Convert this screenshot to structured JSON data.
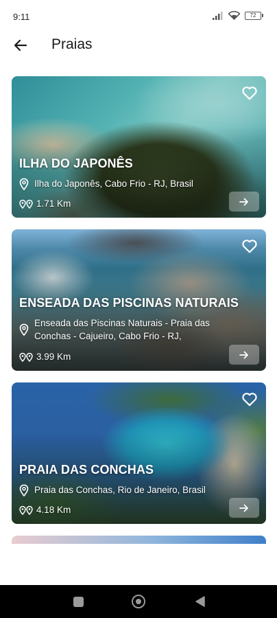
{
  "status": {
    "time": "9:11",
    "battery": "72"
  },
  "header": {
    "title": "Praias",
    "back_icon": "arrow-left-icon"
  },
  "beaches": [
    {
      "title": "ILHA DO JAPONÊS",
      "location": "Ilha do Japonês, Cabo Frio - RJ, Brasil",
      "distance": "1.71 Km",
      "favorite_icon": "heart-outline-icon",
      "go_icon": "arrow-right-icon"
    },
    {
      "title": "ENSEADA DAS PISCINAS NATURAIS",
      "location": "Enseada das Piscinas Naturais - Praia das Conchas - Cajueiro, Cabo Frio - RJ,",
      "distance": "3.99 Km",
      "favorite_icon": "heart-outline-icon",
      "go_icon": "arrow-right-icon"
    },
    {
      "title": "PRAIA DAS CONCHAS",
      "location": "Praia das Conchas, Rio de Janeiro, Brasil",
      "distance": "4.18 Km",
      "favorite_icon": "heart-outline-icon",
      "go_icon": "arrow-right-icon"
    }
  ],
  "nav": {
    "recents": "square-icon",
    "home": "circle-icon",
    "back": "triangle-back-icon"
  }
}
